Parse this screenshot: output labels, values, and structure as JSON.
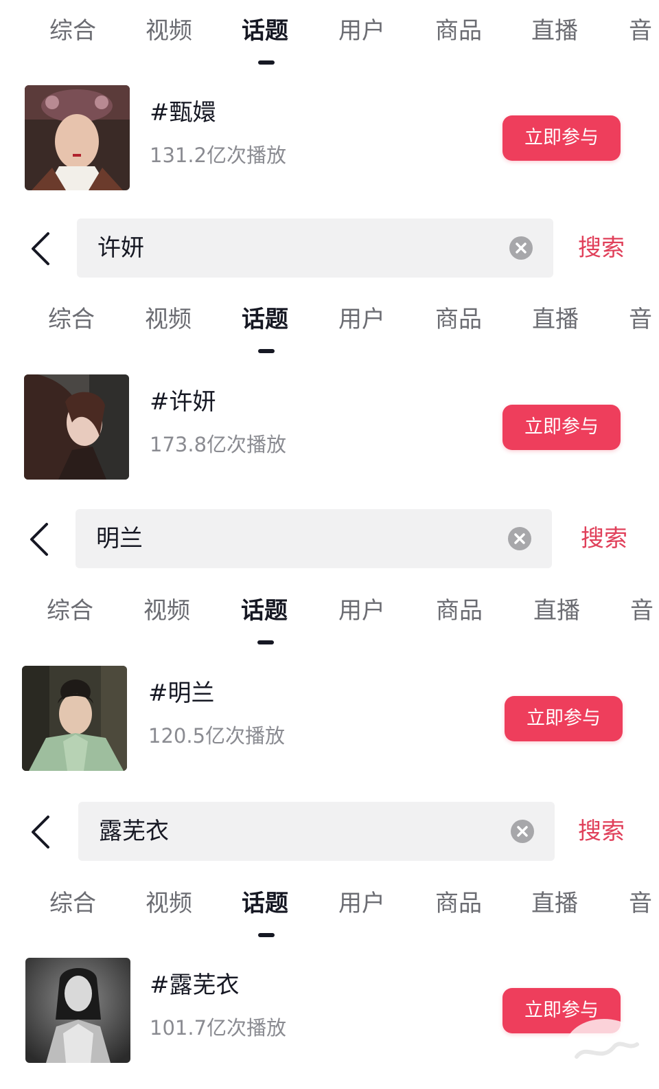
{
  "tabs": {
    "items": [
      "综合",
      "视频",
      "话题",
      "用户",
      "商品",
      "直播",
      "音"
    ],
    "active_index": 2
  },
  "search": {
    "back_icon": "chevron-left-icon",
    "clear_icon": "clear-x-icon",
    "submit_label": "搜索"
  },
  "sections": [
    {
      "query": "",
      "topic": {
        "title": "#甄嬛",
        "plays": "131.2亿次播放",
        "button": "立即参与"
      }
    },
    {
      "query": "许妍",
      "topic": {
        "title": "#许妍",
        "plays": "173.8亿次播放",
        "button": "立即参与"
      }
    },
    {
      "query": "明兰",
      "topic": {
        "title": "#明兰",
        "plays": "120.5亿次播放",
        "button": "立即参与"
      }
    },
    {
      "query": "露芜衣",
      "topic": {
        "title": "#露芜衣",
        "plays": "101.7亿次播放",
        "button": "立即参与"
      }
    }
  ],
  "colors": {
    "accent": "#ee3e5c",
    "search_link": "#e0405a",
    "tab_inactive": "#6b6c72",
    "text_primary": "#161823",
    "text_secondary": "#8a8b91",
    "search_bg": "#f1f1f2"
  }
}
